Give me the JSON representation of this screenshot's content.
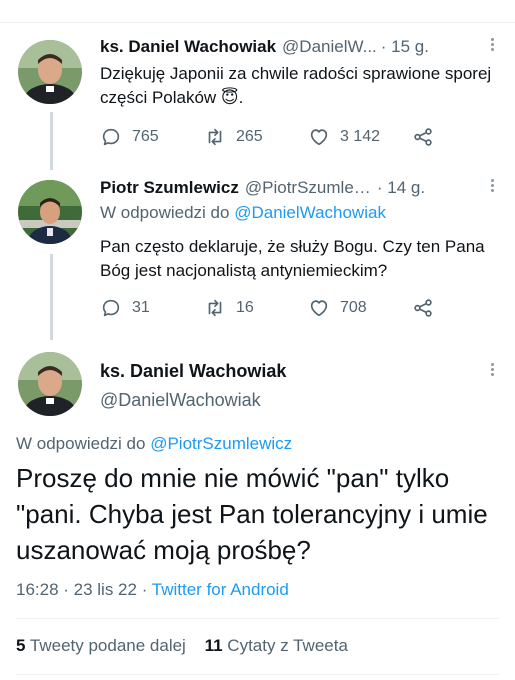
{
  "tweet1": {
    "author_name": "ks. Daniel Wachowiak",
    "author_handle": "@DanielW...",
    "time": "· 15 g.",
    "text": "Dziękuję Japonii za chwile radości sprawione sporej części Polaków 😇.",
    "replies": "765",
    "retweets": "265",
    "likes": "3 142"
  },
  "tweet2": {
    "author_name": "Piotr Szumlewicz",
    "author_handle": "@PiotrSzumlew...",
    "time": "· 14 g.",
    "reply_prefix": "W odpowiedzi do",
    "reply_handle": "@DanielWachowiak",
    "text": "Pan często deklaruje, że służy Bogu. Czy ten Pana Bóg jest nacjonalistą antyniemieckim?",
    "replies": "31",
    "retweets": "16",
    "likes": "708"
  },
  "main_tweet": {
    "author_name": "ks. Daniel Wachowiak",
    "author_handle": "@DanielWachowiak",
    "reply_prefix": "W odpowiedzi do",
    "reply_handle": "@PiotrSzumlewicz",
    "text": "Proszę do mnie nie mówić \"pan\" tylko \"pani. Chyba jest Pan tolerancyjny  i umie uszanować moją prośbę?",
    "timestamp": "16:28 · 23 lis 22 ·",
    "source": "Twitter for Android",
    "retweets_count": "5",
    "retweets_label": "Tweety podane dalej",
    "quotes_count": "11",
    "quotes_label": "Cytaty z Tweeta"
  },
  "colors": {
    "accent": "#1d9bf0",
    "secondary_text": "#536471",
    "primary_text": "#0f1419"
  },
  "icons": [
    "reply-icon",
    "retweet-icon",
    "like-icon",
    "share-icon",
    "more-icon"
  ]
}
